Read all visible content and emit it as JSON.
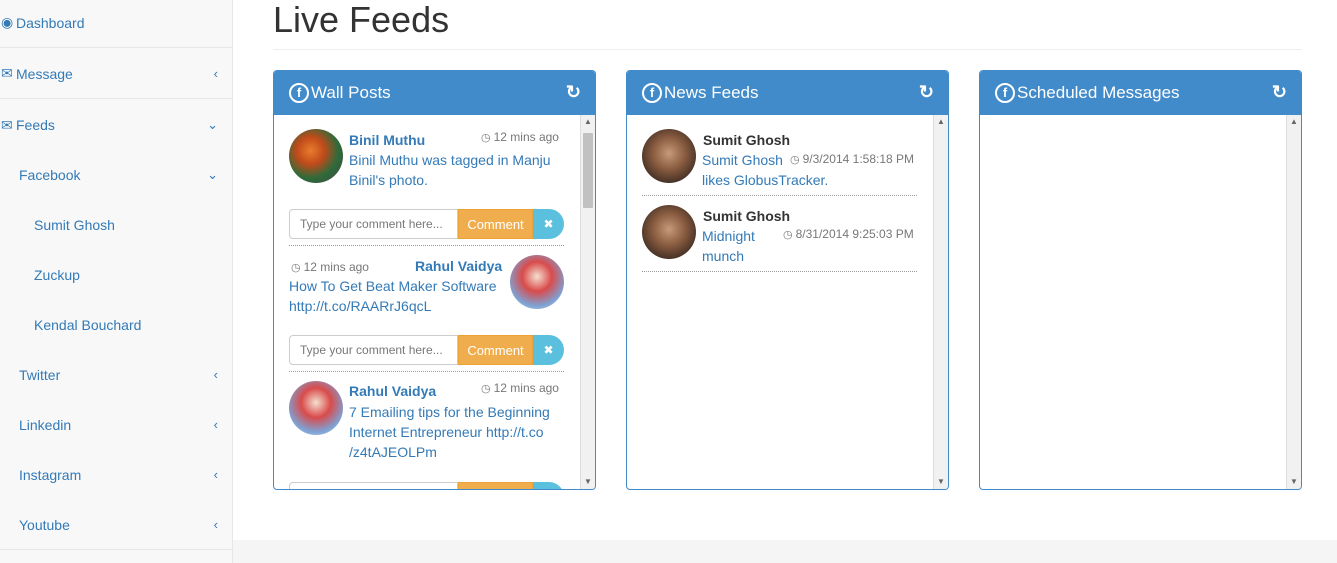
{
  "sidebar": {
    "items": [
      {
        "label": "Dashboard",
        "icon": "dashboard-icon"
      },
      {
        "label": "Message",
        "icon": "envelope-icon"
      },
      {
        "label": "Feeds",
        "icon": "envelope-icon"
      },
      {
        "label": "Facebook"
      },
      {
        "label": "Sumit Ghosh"
      },
      {
        "label": "Zuckup"
      },
      {
        "label": "Kendal Bouchard"
      },
      {
        "label": "Twitter"
      },
      {
        "label": "Linkedin"
      },
      {
        "label": "Instagram"
      },
      {
        "label": "Youtube"
      }
    ]
  },
  "page": {
    "title": "Live Feeds"
  },
  "panels": {
    "wall": {
      "title": "Wall Posts"
    },
    "news": {
      "title": "News Feeds"
    },
    "scheduled": {
      "title": "Scheduled Messages"
    }
  },
  "wall_posts": [
    {
      "name": "Binil Muthu",
      "time": "12 mins ago",
      "line1": "Binil Muthu was tagged in Manju",
      "line2": "Binil's photo."
    },
    {
      "name": "Rahul Vaidya",
      "time": "12 mins ago",
      "line1": "How To Get Beat Maker Software",
      "line2": "http://t.co/RAARrJ6qcL"
    },
    {
      "name": "Rahul Vaidya",
      "time": "12 mins ago",
      "line1": "7 Emailing tips for the Beginning",
      "line2": "Internet Entrepreneur http://t.co",
      "line3": "/z4tAJEOLPm"
    }
  ],
  "comment": {
    "placeholder": "Type your comment here...",
    "button": "Comment"
  },
  "news_feeds": [
    {
      "name": "Sumit Ghosh",
      "line1": "Sumit Ghosh",
      "line2": "likes GlobusTracker.",
      "time": "9/3/2014 1:58:18 PM"
    },
    {
      "name": "Sumit Ghosh",
      "line1": "Midnight",
      "line2": "munch",
      "time": "8/31/2014 9:25:03 PM"
    }
  ],
  "colors": {
    "primary": "#428bca",
    "link": "#337ab7",
    "warning": "#f0ad4e",
    "info": "#5bc0de"
  }
}
